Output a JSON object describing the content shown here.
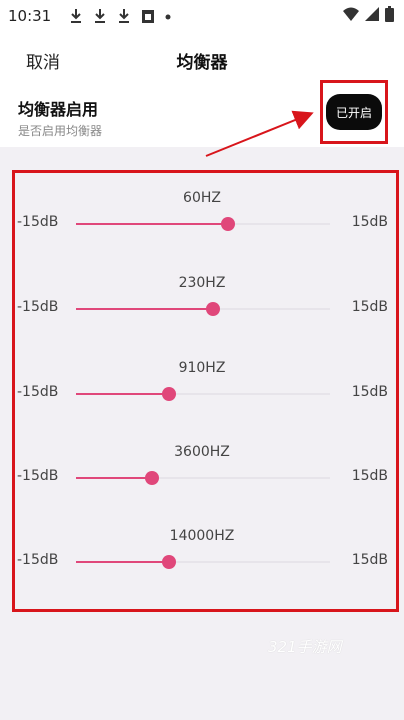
{
  "status_bar": {
    "time": "10:31",
    "icons": [
      "download-icon",
      "download-icon",
      "download-icon",
      "clipboard-icon",
      "dot-icon"
    ],
    "right_icons": [
      "wifi-icon",
      "signal-icon",
      "battery-icon"
    ]
  },
  "header": {
    "cancel_label": "取消",
    "title": "均衡器"
  },
  "enable": {
    "title": "均衡器启用",
    "subtitle": "是否启用均衡器",
    "toggle_label": "已开启"
  },
  "range": {
    "min_label": "-15dB",
    "max_label": "15dB",
    "min": -15,
    "max": 15
  },
  "bands": [
    {
      "freq": "60HZ",
      "value": 3.0
    },
    {
      "freq": "230HZ",
      "value": 1.2
    },
    {
      "freq": "910HZ",
      "value": -4.0
    },
    {
      "freq": "3600HZ",
      "value": -6.0
    },
    {
      "freq": "14000HZ",
      "value": -4.0
    }
  ],
  "colors": {
    "accent": "#e0477a",
    "highlight": "#d8151b",
    "toggle_bg": "#0b0b0b",
    "content_bg": "#f2f0f4"
  },
  "watermark": "321手游网"
}
